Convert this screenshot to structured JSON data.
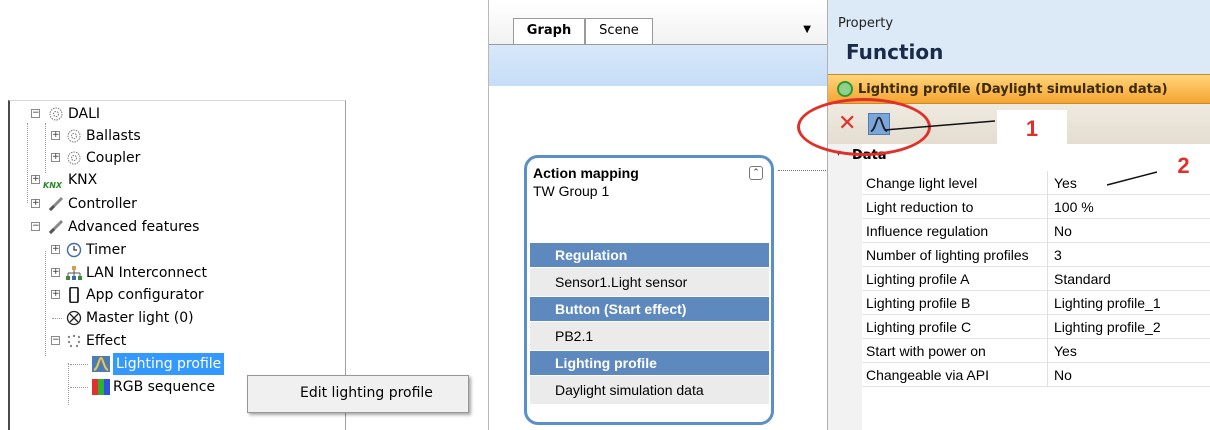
{
  "tree": {
    "items": [
      {
        "label": "DALI",
        "icon": "dali-icon",
        "expander": "−"
      },
      {
        "label": "Ballasts",
        "icon": "dali-icon",
        "expander": "+"
      },
      {
        "label": "Coupler",
        "icon": "dali-icon",
        "expander": "+"
      },
      {
        "label": "KNX",
        "icon": "knx-icon",
        "expander": "+"
      },
      {
        "label": "Controller",
        "icon": "controller-icon",
        "expander": "+"
      },
      {
        "label": "Advanced features",
        "icon": "advanced-features-icon",
        "expander": "−"
      },
      {
        "label": "Timer",
        "icon": "clock-icon",
        "expander": "+"
      },
      {
        "label": "LAN Interconnect",
        "icon": "network-icon",
        "expander": "+"
      },
      {
        "label": "App configurator",
        "icon": "phone-icon",
        "expander": "+"
      },
      {
        "label": "Master light (0)",
        "icon": "master-light-icon",
        "expander": ""
      },
      {
        "label": "Effect",
        "icon": "effect-icon",
        "expander": "−"
      },
      {
        "label": "Lighting profile",
        "icon": "lighting-profile-icon",
        "expander": ""
      },
      {
        "label": "RGB sequence",
        "icon": "rgb-icon",
        "expander": ""
      }
    ],
    "knx_icon_text": "KNX"
  },
  "context_menu": {
    "items": [
      "Edit lighting profile"
    ]
  },
  "graph": {
    "tabs": [
      {
        "label": "Graph"
      },
      {
        "label": "Scene"
      }
    ],
    "dropdown": "▼",
    "node": {
      "title": "Action mapping",
      "subtitle": "TW Group 1",
      "collapse_glyph": "⌃",
      "sections": [
        {
          "header": "Regulation",
          "value": "Sensor1.Light sensor"
        },
        {
          "header": "Button (Start effect)",
          "value": "PB2.1"
        },
        {
          "header": "Lighting profile",
          "value": "Daylight simulation data"
        }
      ]
    }
  },
  "property": {
    "caption": "Property",
    "title": "Function",
    "selected_item": "Lighting profile (Daylight simulation data)",
    "toolbar": {
      "delete_glyph": "✕"
    },
    "group": "Data",
    "rows": [
      {
        "name": "Change light level",
        "value": "Yes"
      },
      {
        "name": "Light reduction to",
        "value": "100 %"
      },
      {
        "name": "Influence regulation",
        "value": "No"
      },
      {
        "name": "Number of lighting profiles",
        "value": "3"
      },
      {
        "name": "Lighting profile A",
        "value": "Standard"
      },
      {
        "name": "Lighting profile B",
        "value": "Lighting profile_1"
      },
      {
        "name": "Lighting profile C",
        "value": "Lighting profile_2"
      },
      {
        "name": "Start with power on",
        "value": "Yes"
      },
      {
        "name": "Changeable via API",
        "value": "No"
      }
    ]
  },
  "annotations": {
    "callout_1": "1",
    "callout_2": "2",
    "color": "#e0302a"
  }
}
